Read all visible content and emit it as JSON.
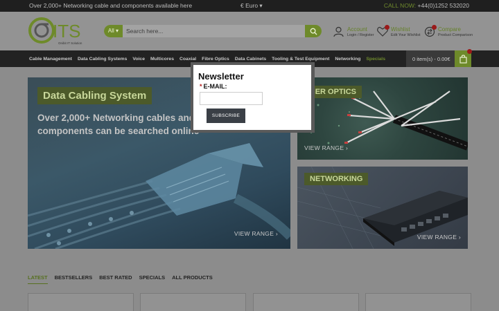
{
  "topbar": {
    "promo": "Over 2,000+ Networking cable and components available here",
    "currency": "€ Euro",
    "call_label": "CALL NOW:",
    "call_number": "+44(0)1252 532020"
  },
  "logo": {
    "text": "ITS",
    "tagline": "Onibit IT Solution"
  },
  "search": {
    "category": "All",
    "placeholder": "Search here..."
  },
  "account": {
    "title": "Account",
    "subtitle": "Login / Register"
  },
  "wishlist": {
    "title": "Wishlist",
    "subtitle": "Edit Your Wishlist"
  },
  "compare": {
    "title": "Compare",
    "subtitle": "Product Comparison"
  },
  "nav": {
    "items": [
      "Cable Management",
      "Data Cabling Systems",
      "Voice",
      "Multicores",
      "Coaxial",
      "Fibre Optics",
      "Data Cabinets",
      "Tooling & Test Equipment",
      "Networking",
      "Specials"
    ]
  },
  "cart": {
    "label": "0 item(s) - 0.00€"
  },
  "banners": {
    "main": {
      "title": "Data Cabling System",
      "subtitle": "Over 2,000+ Networking cables and components can be searched online",
      "cta": "VIEW RANGE"
    },
    "fiber": {
      "title": "FIBER OPTICS",
      "cta": "VIEW RANGE"
    },
    "networking": {
      "title": "NETWORKING",
      "cta": "VIEW RANGE"
    }
  },
  "tabs": [
    "LATEST",
    "BESTSELLERS",
    "BEST RATED",
    "SPECIALS",
    "ALL PRODUCTS"
  ],
  "newsletter": {
    "title": "Newsletter",
    "email_label": "E-MAIL:",
    "button": "SUBSCRIBE"
  },
  "colors": {
    "accent": "#6e8a2a",
    "dark": "#222222",
    "badge": "#9a1a1a"
  }
}
